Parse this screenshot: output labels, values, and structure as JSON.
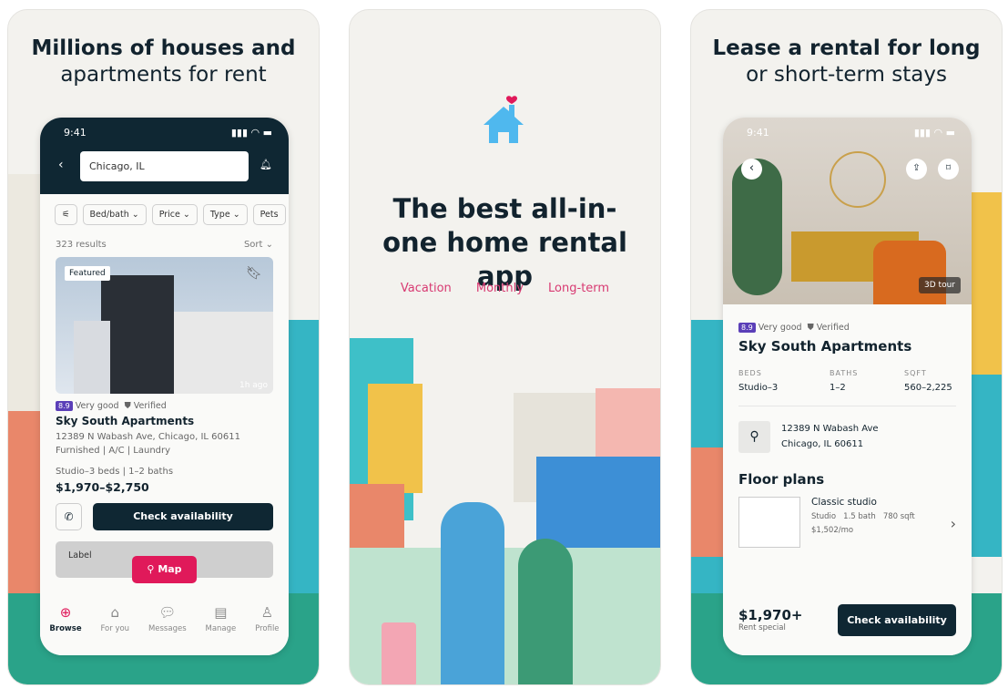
{
  "panel1": {
    "headline_bold": "Millions of houses and",
    "headline": "apartments for rent",
    "time": "9:41",
    "search_value": "Chicago, IL",
    "filters": [
      "Bed/bath ⌄",
      "Price ⌄",
      "Type ⌄",
      "Pets"
    ],
    "results": "323 results",
    "sort": "Sort ⌄",
    "featured": "Featured",
    "posted": "1h ago",
    "rating": "8.9",
    "rating_label": "Very good",
    "verified": "Verified",
    "name": "Sky South Apartments",
    "address": "12389 N Wabash Ave, Chicago, IL 60611",
    "amenities": "Furnished | A/C | Laundry",
    "beds_baths": "Studio–3 beds | 1–2 baths",
    "price": "$1,970–$2,750",
    "check_availability": "Check availability",
    "map": "Map",
    "label": "Label",
    "nav": [
      "Browse",
      "For you",
      "Messages",
      "Manage",
      "Profile"
    ]
  },
  "panel2": {
    "headline": "The best all-in-one home rental app",
    "categories": [
      "Vacation",
      "Monthly",
      "Long-term"
    ]
  },
  "panel3": {
    "headline_bold": "Lease a rental for long",
    "headline": "or short-term stays",
    "time": "9:41",
    "tour": "3D tour",
    "rating": "8.9",
    "rating_label": "Very good",
    "verified": "Verified",
    "name": "Sky South Apartments",
    "stats": [
      {
        "label": "BEDS",
        "value": "Studio–3"
      },
      {
        "label": "BATHS",
        "value": "1–2"
      },
      {
        "label": "SQFT",
        "value": "560–2,225"
      }
    ],
    "address1": "12389 N Wabash Ave",
    "address2": "Chicago, IL 60611",
    "floor_plans": "Floor plans",
    "plan_name": "Classic studio",
    "plan_details": "Studio   1.5 bath   780 sqft",
    "plan_price": "$1,502/mo",
    "price": "$1,970+",
    "price_note": "Rent special",
    "check_availability": "Check availability"
  },
  "colors": {
    "navy": "#0f2733",
    "pink": "#e0195a",
    "house_blue": "#4fb8ee",
    "rating_purple": "#5b3fb8"
  }
}
